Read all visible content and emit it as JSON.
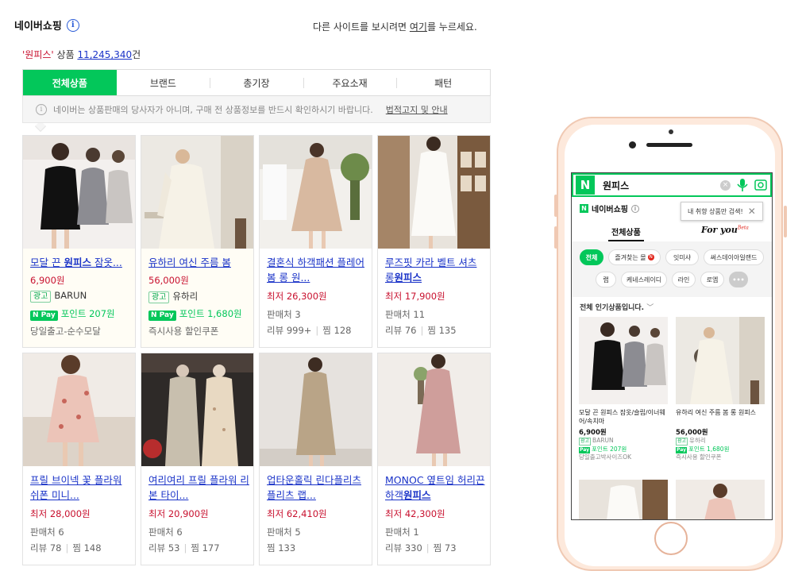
{
  "header": {
    "title": "네이버쇼핑",
    "redirect_prefix": "다른 사이트를 보시려면 ",
    "redirect_link": "여기",
    "redirect_suffix": "를 누르세요."
  },
  "result": {
    "query": "'원피스'",
    "label": " 상품 ",
    "count": "11,245,340",
    "unit": "건"
  },
  "tabs": [
    "전체상품",
    "브랜드",
    "총기장",
    "주요소재",
    "패턴"
  ],
  "notice": {
    "icon": "i",
    "text": "네이버는 상품판매의 당사자가 아니며, 구매 전 상품정보를 반드시 확인하시기 바랍니다.",
    "link": "법적고지 및 안내"
  },
  "products": [
    {
      "title_pre": "모달 끈 ",
      "title_bold": "원피스",
      "title_post": " 잠옷...",
      "price": "6,900원",
      "ad": "광고",
      "seller": "BARUN",
      "npay": "N Pay",
      "point": "포인트 207원",
      "extra": "당일출고-순수모달"
    },
    {
      "title_pre": "유하리 여신 주름 봄 ",
      "title_bold": "",
      "title_post": "",
      "price": "56,000원",
      "ad": "광고",
      "seller": "유하리",
      "npay": "N Pay",
      "point": "포인트 1,680원",
      "extra": "즉시사용 할인쿠폰"
    },
    {
      "title_pre": "결혼식 하객패션 플레어 봄 롱 원...",
      "title_bold": "",
      "title_post": "",
      "price": "최저 26,300원",
      "sellers": "판매처 3",
      "review": "리뷰 999+",
      "wish": "찜 128"
    },
    {
      "title_pre": "루즈핏 카라 벨트 셔츠 롱",
      "title_bold": "원피스",
      "title_post": "",
      "price": "최저 17,900원",
      "sellers": "판매처 11",
      "review": "리뷰 76",
      "wish": "찜 135"
    },
    {
      "title_pre": "프릴 브이넥 꽃 플라워 쉬폰 미니...",
      "title_bold": "",
      "title_post": "",
      "price": "최저 28,000원",
      "sellers": "판매처 6",
      "review": "리뷰 78",
      "wish": "찜 148"
    },
    {
      "title_pre": "여리여리 프릴 플라워 리본 타이...",
      "title_bold": "",
      "title_post": "",
      "price": "최저 20,900원",
      "sellers": "판매처 6",
      "review": "리뷰 53",
      "wish": "찜 177"
    },
    {
      "title_pre": "업타운홀릭 린다플리츠 플리츠 랩...",
      "title_bold": "",
      "title_post": "",
      "price": "최저 62,410원",
      "sellers": "판매처 5",
      "review": "",
      "wish": "찜 133"
    },
    {
      "title_pre": "MONOC 옆트임 허리끈 하객",
      "title_bold": "원피스",
      "title_post": "",
      "price": "최저 42,300원",
      "sellers": "판매처 1",
      "review": "리뷰 330",
      "wish": "찜 73"
    }
  ],
  "mobile": {
    "logo": "N",
    "query": "원피스",
    "clear": "×",
    "shop_badge": "N",
    "shop_title": "네이버쇼핑",
    "shop_info": "i",
    "tooltip": "내 취향 상품만 검색!",
    "tooltip_close": "✕",
    "tab_all": "전체상품",
    "tab_foryou": "For you",
    "tab_foryou_sup": "Beta",
    "chips": [
      "전체",
      "즐겨찾는 몰",
      "잇미샤",
      "써스데이아일랜드",
      "랩",
      "케네스레이디",
      "라인",
      "로엠",
      "•••"
    ],
    "chip_badge": "N",
    "popular": "전체 인기상품입니다.",
    "popular_arrow": "﹀",
    "products": [
      {
        "title": "모달 끈 원피스 잠옷/슬립/이너웨어/속치마",
        "price": "6,900원",
        "ad": "광고",
        "seller": "BARUN",
        "npay": "Pay",
        "point": "포인트 207원",
        "extra": "당일출고박사이즈OK"
      },
      {
        "title": "유하리 여신 주름 봄 롱 원피스",
        "price": "56,000원",
        "ad": "광고",
        "seller": "유하리",
        "npay": "Pay",
        "point": "포인트 1,680원",
        "extra": "즉시사용 할인쿠폰"
      }
    ]
  }
}
